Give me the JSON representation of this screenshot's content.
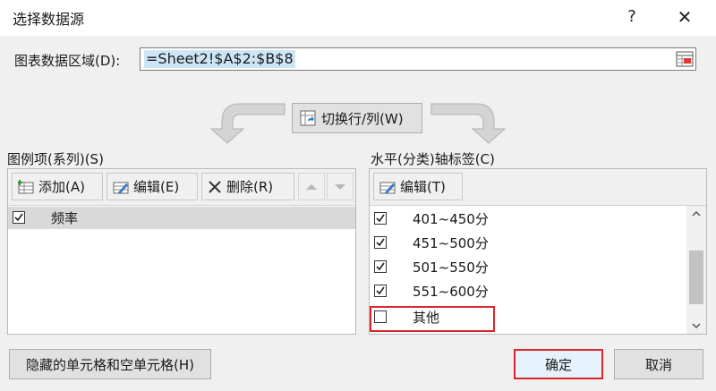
{
  "dialog": {
    "title": "选择数据源",
    "help_label": "?",
    "close_label": "✕"
  },
  "range": {
    "label": "图表数据区域(D):",
    "value": "=Sheet2!$A$2:$B$8"
  },
  "switch_label": "切换行/列(W)",
  "legend": {
    "label": "图例项(系列)(S)",
    "add_label": "添加(A)",
    "edit_label": "编辑(E)",
    "delete_label": "删除(R)",
    "items": [
      {
        "name": "频率",
        "checked": true
      }
    ]
  },
  "axis": {
    "label": "水平(分类)轴标签(C)",
    "edit_label": "编辑(T)",
    "items": [
      {
        "name": "401~450分",
        "checked": true
      },
      {
        "name": "451~500分",
        "checked": true
      },
      {
        "name": "501~550分",
        "checked": true
      },
      {
        "name": "551~600分",
        "checked": true
      },
      {
        "name": "其他",
        "checked": false
      }
    ]
  },
  "footer": {
    "hidden_cells_label": "隐藏的单元格和空单元格(H)",
    "ok_label": "确定",
    "cancel_label": "取消"
  },
  "colors": {
    "highlight": "#d9262b",
    "selection": "#cde6f7"
  }
}
